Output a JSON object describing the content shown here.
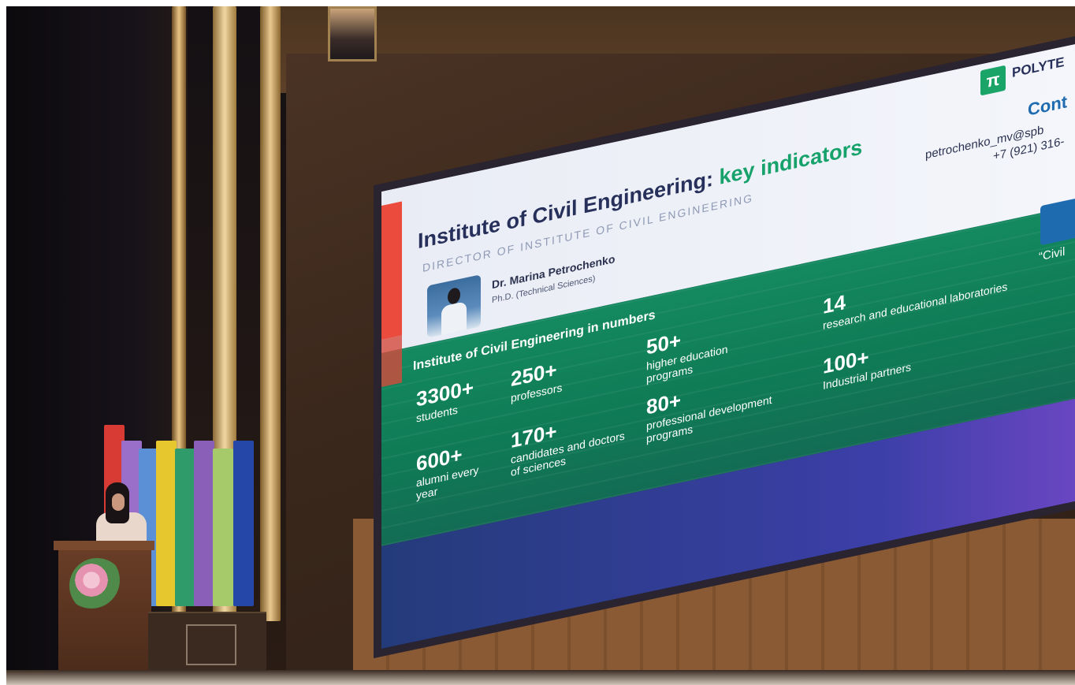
{
  "slide": {
    "title_main": "Institute of Civil Engineering: ",
    "title_highlight": "key indicators",
    "director_label": "DIRECTOR OF INSTITUTE OF CIVIL ENGINEERING",
    "director_name": "Dr. Marina Petrochenko",
    "director_degree": "Ph.D. (Technical Sciences)",
    "logo_text": "POLYTE",
    "contacts_heading": "Cont",
    "contacts_email": "petrochenko_mv@spb",
    "contacts_phone": "+7 (921) 316-",
    "numbers_heading": "Institute of Civil Engineering in numbers",
    "side_quote": "“Civil",
    "stats": [
      {
        "value": "3300+",
        "label": "students"
      },
      {
        "value": "250+",
        "label": "professors"
      },
      {
        "value": "50+",
        "label": "higher education programs"
      },
      {
        "value": "14",
        "label": "research and educational laboratories"
      },
      {
        "value": "600+",
        "label": "alumni every year"
      },
      {
        "value": "170+",
        "label": "candidates and doctors of sciences"
      },
      {
        "value": "80+",
        "label": "professional development programs"
      },
      {
        "value": "100+",
        "label": "Industrial partners"
      }
    ]
  },
  "colors": {
    "slide_green": "#0f7a55",
    "highlight_green": "#17a26b",
    "accent_red": "#ea4b3c",
    "stage_wood": "#8a5a34"
  }
}
